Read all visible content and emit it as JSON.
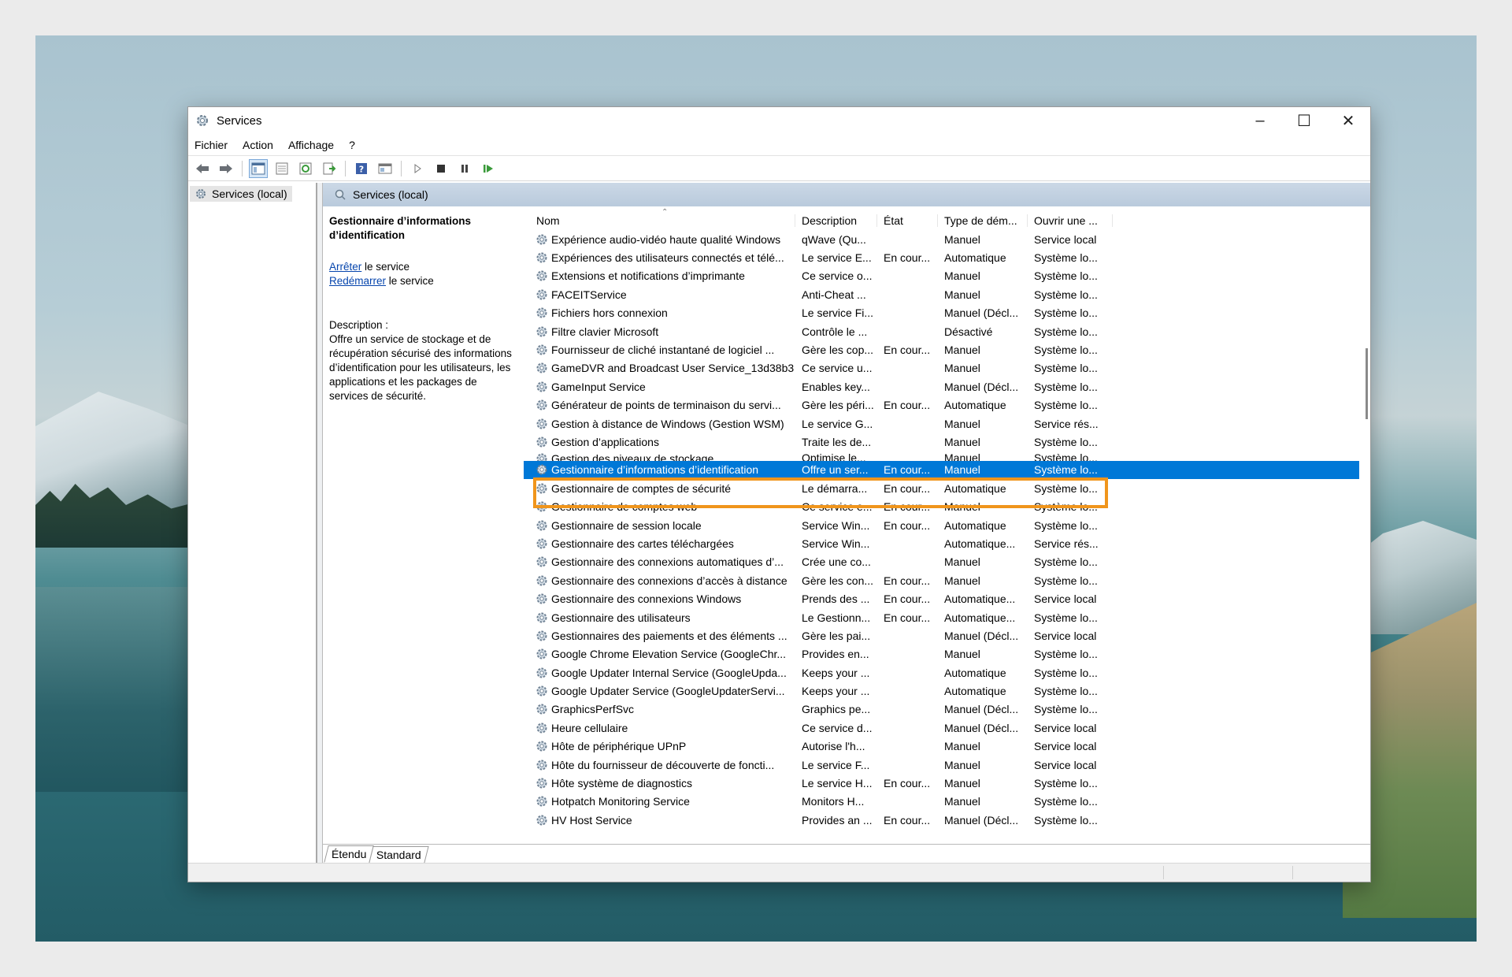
{
  "window": {
    "title": "Services"
  },
  "menu": [
    "Fichier",
    "Action",
    "Affichage",
    "?"
  ],
  "tree": {
    "root_label": "Services (local)"
  },
  "pane": {
    "header": "Services (local)"
  },
  "details": {
    "service_title": "Gestionnaire d’informations d’identification",
    "stop_link": "Arrêter",
    "stop_suffix": " le service",
    "restart_link": "Redémarrer",
    "restart_suffix": " le service",
    "description_label": "Description :",
    "description_text": "Offre un service de stockage et de récupération sécurisé des informations d’identification pour les utilisateurs, les applications et les packages de services de sécurité."
  },
  "columns": {
    "name": "Nom",
    "description": "Description",
    "state": "État",
    "startup_type": "Type de dém...",
    "logon_as": "Ouvrir une ..."
  },
  "rows": [
    {
      "name": "Expérience audio-vidéo haute qualité Windows",
      "description": "qWave (Qu...",
      "state": "",
      "startup_type": "Manuel",
      "logon_as": "Service local"
    },
    {
      "name": "Expériences des utilisateurs connectés et télé...",
      "description": "Le service E...",
      "state": "En cour...",
      "startup_type": "Automatique",
      "logon_as": "Système lo..."
    },
    {
      "name": "Extensions et notifications d’imprimante",
      "description": "Ce service o...",
      "state": "",
      "startup_type": "Manuel",
      "logon_as": "Système lo..."
    },
    {
      "name": "FACEITService",
      "description": "Anti-Cheat ...",
      "state": "",
      "startup_type": "Manuel",
      "logon_as": "Système lo..."
    },
    {
      "name": "Fichiers hors connexion",
      "description": "Le service Fi...",
      "state": "",
      "startup_type": "Manuel (Décl...",
      "logon_as": "Système lo..."
    },
    {
      "name": "Filtre clavier Microsoft",
      "description": "Contrôle le ...",
      "state": "",
      "startup_type": "Désactivé",
      "logon_as": "Système lo..."
    },
    {
      "name": "Fournisseur de cliché instantané de logiciel ...",
      "description": "Gère les cop...",
      "state": "En cour...",
      "startup_type": "Manuel",
      "logon_as": "Système lo..."
    },
    {
      "name": "GameDVR and Broadcast User Service_13d38b3",
      "description": "Ce service u...",
      "state": "",
      "startup_type": "Manuel",
      "logon_as": "Système lo..."
    },
    {
      "name": "GameInput Service",
      "description": "Enables key...",
      "state": "",
      "startup_type": "Manuel (Décl...",
      "logon_as": "Système lo..."
    },
    {
      "name": "Générateur de points de terminaison du servi...",
      "description": "Gère les péri...",
      "state": "En cour...",
      "startup_type": "Automatique",
      "logon_as": "Système lo..."
    },
    {
      "name": "Gestion à distance de Windows (Gestion WSM)",
      "description": "Le service G...",
      "state": "",
      "startup_type": "Manuel",
      "logon_as": "Service rés..."
    },
    {
      "name": "Gestion d’applications",
      "description": "Traite les de...",
      "state": "",
      "startup_type": "Manuel",
      "logon_as": "Système lo..."
    },
    {
      "name": "Gestion des niveaux de stockage",
      "description": "Optimise le...",
      "state": "",
      "startup_type": "Manuel",
      "logon_as": "Système lo..."
    },
    {
      "name": "Gestionnaire d’informations d’identification",
      "description": "Offre un ser...",
      "state": "En cour...",
      "startup_type": "Manuel",
      "logon_as": "Système lo...",
      "selected": true
    },
    {
      "name": "Gestionnaire de comptes de sécurité",
      "description": "Le démarra...",
      "state": "En cour...",
      "startup_type": "Automatique",
      "logon_as": "Système lo..."
    },
    {
      "name": "Gestionnaire de comptes web",
      "description": "Ce service e...",
      "state": "En cour...",
      "startup_type": "Manuel",
      "logon_as": "Système lo..."
    },
    {
      "name": "Gestionnaire de session locale",
      "description": "Service Win...",
      "state": "En cour...",
      "startup_type": "Automatique",
      "logon_as": "Système lo..."
    },
    {
      "name": "Gestionnaire des cartes téléchargées",
      "description": "Service Win...",
      "state": "",
      "startup_type": "Automatique...",
      "logon_as": "Service rés..."
    },
    {
      "name": "Gestionnaire des connexions automatiques d’...",
      "description": "Crée une co...",
      "state": "",
      "startup_type": "Manuel",
      "logon_as": "Système lo..."
    },
    {
      "name": "Gestionnaire des connexions d’accès à distance",
      "description": "Gère les con...",
      "state": "En cour...",
      "startup_type": "Manuel",
      "logon_as": "Système lo..."
    },
    {
      "name": "Gestionnaire des connexions Windows",
      "description": "Prends des ...",
      "state": "En cour...",
      "startup_type": "Automatique...",
      "logon_as": "Service local"
    },
    {
      "name": "Gestionnaire des utilisateurs",
      "description": "Le Gestionn...",
      "state": "En cour...",
      "startup_type": "Automatique...",
      "logon_as": "Système lo..."
    },
    {
      "name": "Gestionnaires des paiements et des éléments ...",
      "description": "Gère les pai...",
      "state": "",
      "startup_type": "Manuel (Décl...",
      "logon_as": "Service local"
    },
    {
      "name": "Google Chrome Elevation Service (GoogleChr...",
      "description": "Provides en...",
      "state": "",
      "startup_type": "Manuel",
      "logon_as": "Système lo..."
    },
    {
      "name": "Google Updater Internal Service (GoogleUpda...",
      "description": "Keeps your ...",
      "state": "",
      "startup_type": "Automatique",
      "logon_as": "Système lo..."
    },
    {
      "name": "Google Updater Service (GoogleUpdaterServi...",
      "description": "Keeps your ...",
      "state": "",
      "startup_type": "Automatique",
      "logon_as": "Système lo..."
    },
    {
      "name": "GraphicsPerfSvc",
      "description": "Graphics pe...",
      "state": "",
      "startup_type": "Manuel (Décl...",
      "logon_as": "Système lo..."
    },
    {
      "name": "Heure cellulaire",
      "description": "Ce service d...",
      "state": "",
      "startup_type": "Manuel (Décl...",
      "logon_as": "Service local"
    },
    {
      "name": "Hôte de périphérique UPnP",
      "description": "Autorise l'h...",
      "state": "",
      "startup_type": "Manuel",
      "logon_as": "Service local"
    },
    {
      "name": "Hôte du fournisseur de découverte de foncti...",
      "description": "Le service F...",
      "state": "",
      "startup_type": "Manuel",
      "logon_as": "Service local"
    },
    {
      "name": "Hôte système de diagnostics",
      "description": "Le service H...",
      "state": "En cour...",
      "startup_type": "Manuel",
      "logon_as": "Système lo..."
    },
    {
      "name": "Hotpatch Monitoring Service",
      "description": "Monitors H...",
      "state": "",
      "startup_type": "Manuel",
      "logon_as": "Système lo..."
    },
    {
      "name": "HV Host Service",
      "description": "Provides an ...",
      "state": "En cour...",
      "startup_type": "Manuel (Décl...",
      "logon_as": "Système lo..."
    }
  ],
  "tabs": [
    "Étendu",
    "Standard"
  ],
  "colors": {
    "selection": "#0078d7",
    "highlight_box": "#f0951c",
    "pane_header": "#c1d0e0"
  }
}
